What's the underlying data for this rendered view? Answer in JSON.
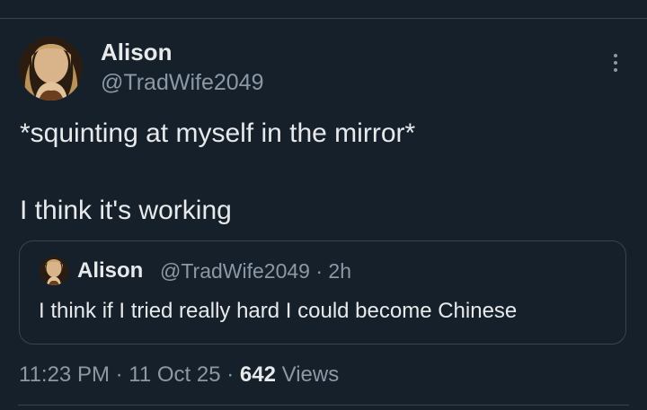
{
  "tweet": {
    "author": {
      "display_name": "Alison",
      "handle": "@TradWife2049",
      "avatar_icon": "profile-photo"
    },
    "text_lines": [
      "*squinting at myself in the mirror*",
      "I think it's working"
    ],
    "more_icon": "more-options-icon"
  },
  "quote": {
    "display_name": "Alison",
    "handle": "@TradWife2049",
    "separator": "·",
    "time_ago": "2h",
    "text": "I think if I tried really hard I could become Chinese"
  },
  "meta": {
    "time": "11:23 PM",
    "separator": "·",
    "date": "11 Oct 25",
    "views_count": "642",
    "views_label": "Views"
  },
  "colors": {
    "background": "#15202b",
    "primary_text": "#e7e9ea",
    "secondary_text": "#8b98a5",
    "border": "#38444d"
  }
}
